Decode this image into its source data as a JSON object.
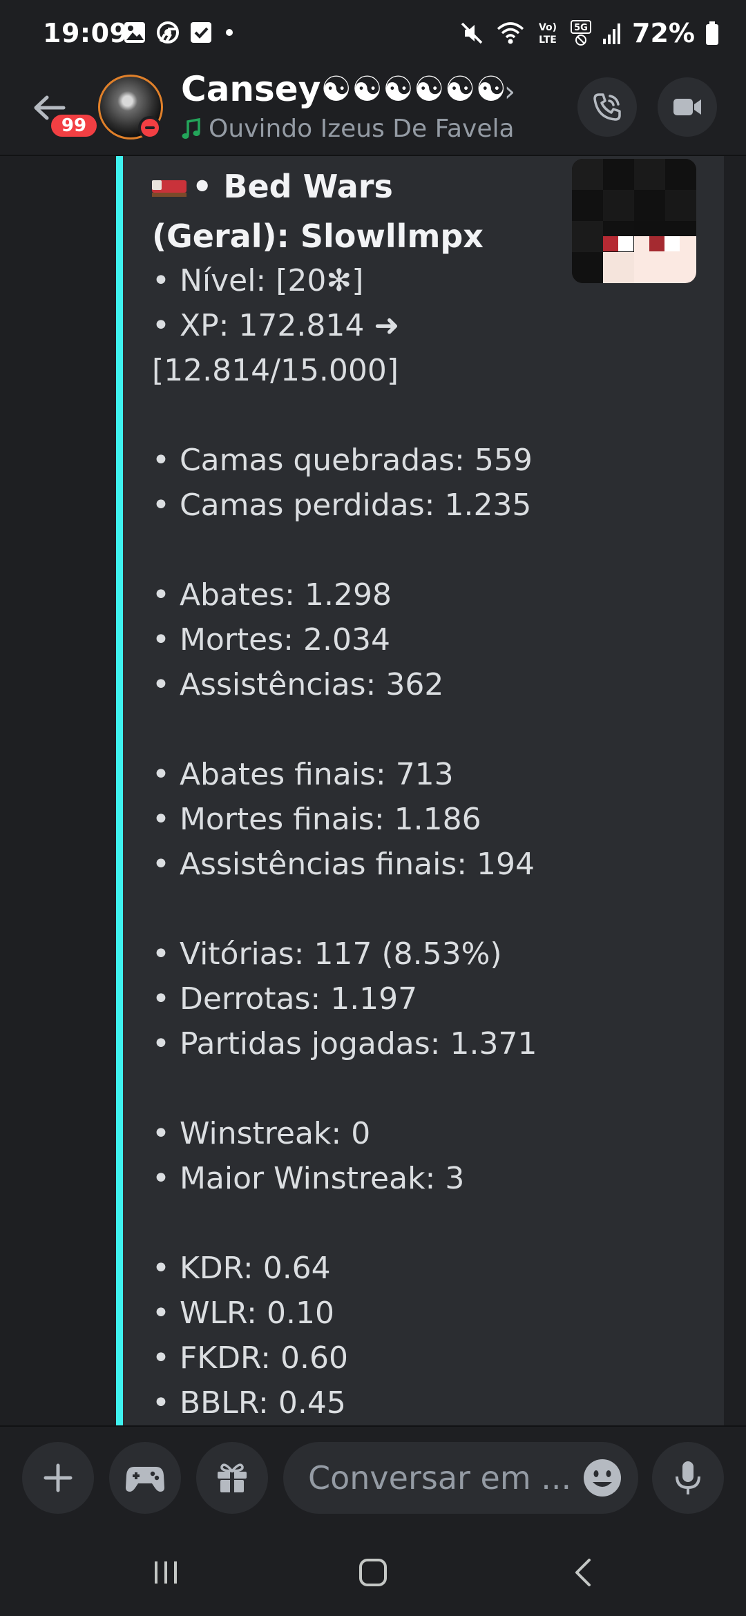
{
  "status_bar": {
    "time": "19:09",
    "battery": "72%"
  },
  "header": {
    "unread_count": "99",
    "channel_name": "Cansey☯☯☯☯☯☯",
    "name_chevron": "›",
    "activity_text": "Ouvindo Izeus De Favela",
    "activity_icon": "music-note-icon",
    "status": "do-not-disturb",
    "colors": {
      "status_dnd": "#f23f43",
      "badge": "#f23f43",
      "activity_icon": "#23a55a"
    }
  },
  "embed": {
    "accent_color": "#3ff2f0",
    "title_icon": "bed-emoji",
    "title": "• Bed Wars (Geral): Slowllmpx",
    "groups": [
      [
        "• Nível: [20✻]",
        "• XP: 172.814 ➜",
        "[12.814/15.000]"
      ],
      [
        "• Camas quebradas: 559",
        "• Camas perdidas: 1.235"
      ],
      [
        "• Abates: 1.298",
        "• Mortes: 2.034",
        "• Assistências: 362"
      ],
      [
        "• Abates finais: 713",
        "• Mortes finais: 1.186",
        "• Assistências finais: 194"
      ],
      [
        "• Vitórias: 117 (8.53%)",
        "• Derrotas: 1.197",
        "• Partidas jogadas: 1.371"
      ],
      [
        "• Winstreak: 0",
        "• Maior Winstreak: 3"
      ],
      [
        "• KDR: 0.64",
        "• WLR: 0.10",
        "• FKDR: 0.60",
        "• BBLR: 0.45"
      ]
    ]
  },
  "input_bar": {
    "placeholder": "Conversar em ..."
  }
}
